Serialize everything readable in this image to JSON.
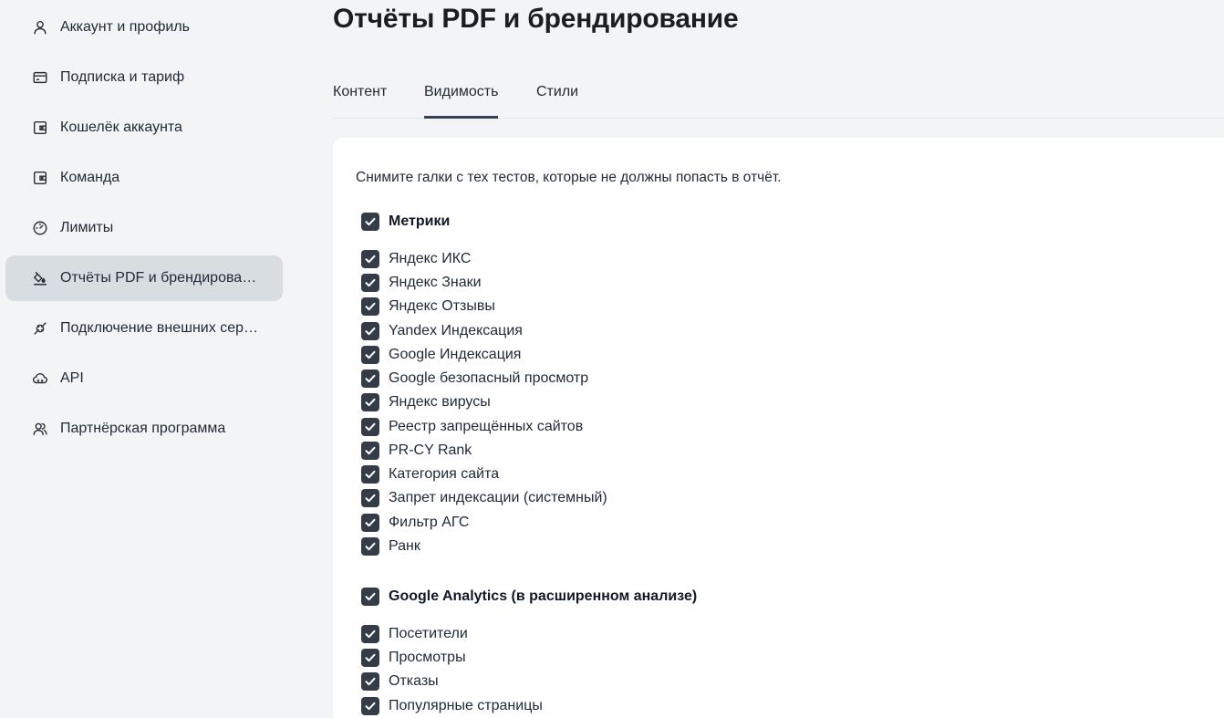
{
  "sidebar": {
    "items": [
      {
        "label": "Аккаунт и профиль",
        "icon": "user-icon"
      },
      {
        "label": "Подписка и тариф",
        "icon": "credit-card-icon"
      },
      {
        "label": "Кошелёк аккаунта",
        "icon": "wallet-icon"
      },
      {
        "label": "Команда",
        "icon": "wallet-icon"
      },
      {
        "label": "Лимиты",
        "icon": "gauge-icon"
      },
      {
        "label": "Отчёты PDF и брендирова…",
        "icon": "paint-bucket-icon",
        "active": true
      },
      {
        "label": "Подключение внешних сер…",
        "icon": "plug-icon"
      },
      {
        "label": "API",
        "icon": "cloud-icon"
      },
      {
        "label": "Партнёрская программа",
        "icon": "users-icon"
      }
    ]
  },
  "page": {
    "title": "Отчёты PDF и брендирование"
  },
  "tabs": [
    {
      "label": "Контент"
    },
    {
      "label": "Видимость",
      "active": true
    },
    {
      "label": "Стили"
    }
  ],
  "content": {
    "hint": "Снимите галки с тех тестов, которые не должны попасть в отчёт.",
    "groups": [
      {
        "title": "Метрики",
        "checked": true,
        "items": [
          {
            "label": "Яндекс ИКС",
            "checked": true
          },
          {
            "label": "Яндекс Знаки",
            "checked": true
          },
          {
            "label": "Яндекс Отзывы",
            "checked": true
          },
          {
            "label": "Yandex Индексация",
            "checked": true
          },
          {
            "label": "Google Индексация",
            "checked": true
          },
          {
            "label": "Google безопасный просмотр",
            "checked": true
          },
          {
            "label": "Яндекс вирусы",
            "checked": true
          },
          {
            "label": "Реестр запрещённых сайтов",
            "checked": true
          },
          {
            "label": "PR-CY Rank",
            "checked": true
          },
          {
            "label": "Категория сайта",
            "checked": true
          },
          {
            "label": "Запрет индексации (системный)",
            "checked": true
          },
          {
            "label": "Фильтр АГС",
            "checked": true
          },
          {
            "label": "Ранк",
            "checked": true
          }
        ]
      },
      {
        "title": "Google Analytics (в расширенном анализе)",
        "checked": true,
        "items": [
          {
            "label": "Посетители",
            "checked": true
          },
          {
            "label": "Просмотры",
            "checked": true
          },
          {
            "label": "Отказы",
            "checked": true
          },
          {
            "label": "Популярные страницы",
            "checked": true
          }
        ]
      }
    ]
  },
  "colors": {
    "background": "#f3f4f6",
    "active_item": "#d8dde1",
    "checkbox": "#343c47",
    "card": "#ffffff"
  }
}
